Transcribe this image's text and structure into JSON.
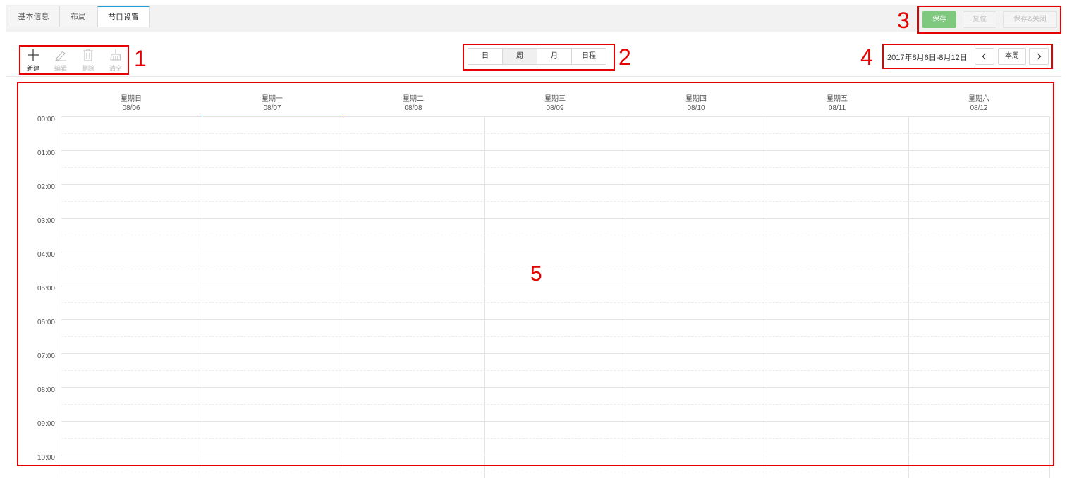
{
  "tabs": [
    {
      "label": "基本信息",
      "active": false
    },
    {
      "label": "布局",
      "active": false
    },
    {
      "label": "节目设置",
      "active": true
    }
  ],
  "actions": {
    "save": "保存",
    "reset": "复位",
    "save_close": "保存&关闭"
  },
  "toolbar": {
    "new": "新建",
    "edit": "编辑",
    "delete": "删除",
    "clear": "清空"
  },
  "views": [
    "日",
    "周",
    "月",
    "日程"
  ],
  "active_view": "周",
  "date_nav": {
    "range": "2017年8月6日-8月12日",
    "prev_icon": "chevron-left-icon",
    "this_week": "本周",
    "next_icon": "chevron-right-icon"
  },
  "calendar": {
    "days": [
      {
        "weekday": "星期日",
        "date": "08/06"
      },
      {
        "weekday": "星期一",
        "date": "08/07"
      },
      {
        "weekday": "星期二",
        "date": "08/08"
      },
      {
        "weekday": "星期三",
        "date": "08/09"
      },
      {
        "weekday": "星期四",
        "date": "08/10"
      },
      {
        "weekday": "星期五",
        "date": "08/11"
      },
      {
        "weekday": "星期六",
        "date": "08/12"
      }
    ],
    "today": "08/07",
    "hours": [
      "00:00",
      "01:00",
      "02:00",
      "03:00",
      "04:00",
      "05:00",
      "06:00",
      "07:00",
      "08:00",
      "09:00",
      "10:00"
    ]
  },
  "annotations": [
    "1",
    "2",
    "3",
    "4",
    "5"
  ],
  "colors": {
    "accent": "#1ba1d6",
    "save_green": "#7fc97f",
    "annotation_red": "#e60000"
  }
}
